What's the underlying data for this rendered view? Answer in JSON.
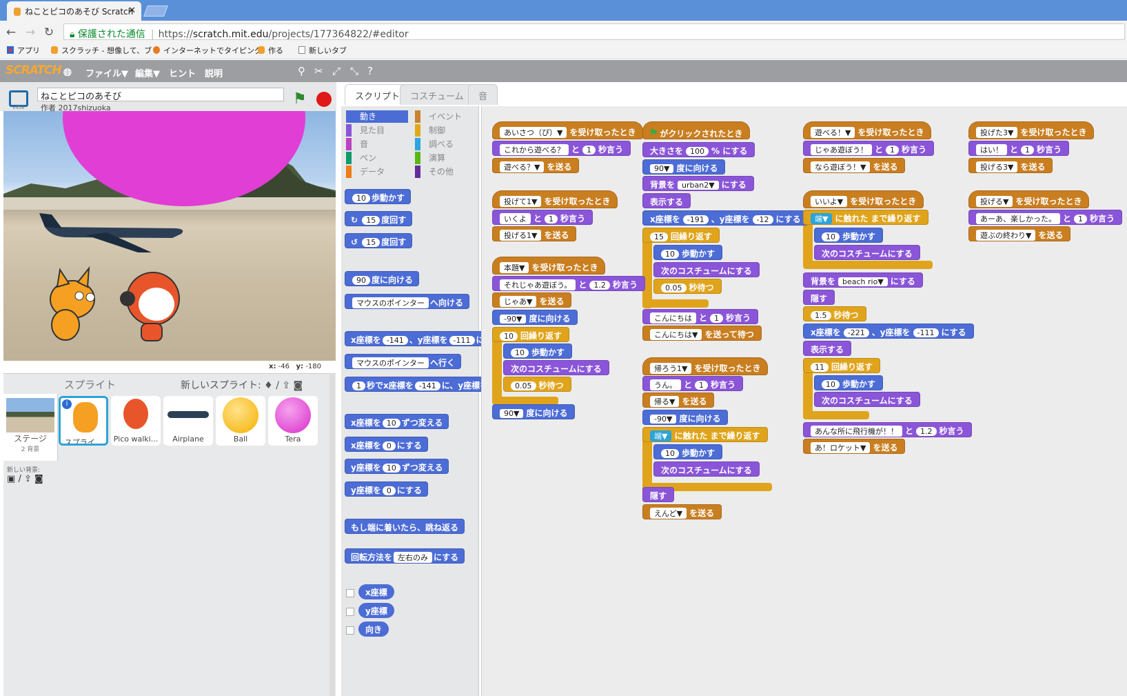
{
  "browser": {
    "tab_title": "ねことピコのあそび Scratch",
    "security_label": "保護された通信",
    "url_prefix": "https://",
    "url_host": "scratch.mit.edu",
    "url_path": "/projects/177364822/#editor",
    "bookmarks": [
      "アプリ",
      "スクラッチ - 想像して、ブ",
      "インターネットでタイピング",
      "作る",
      "新しいタブ"
    ]
  },
  "menubar": {
    "logo": "SCRATCH",
    "file": "ファイル▼",
    "edit": "編集▼",
    "hint": "ヒント",
    "about": "説明"
  },
  "stage": {
    "project_title": "ねことピコのあそび",
    "author": "作者 2017shizuoka",
    "version": "v458",
    "x_label": "x:",
    "x_value": "-46",
    "y_label": "y:",
    "y_value": "-180"
  },
  "sprites": {
    "header": "スプライト",
    "new_sprite": "新しいスプライト:",
    "stage_label": "ステージ",
    "stage_sub": "2 背景",
    "new_bg": "新しい背景:",
    "items": [
      "スプライ...",
      "Pico walki...",
      "Airplane",
      "Ball",
      "Tera"
    ]
  },
  "tabs": [
    "スクリプト",
    "コスチューム",
    "音"
  ],
  "categories": {
    "left": [
      "動き",
      "見た目",
      "音",
      "ペン",
      "データ"
    ],
    "right": [
      "イベント",
      "制御",
      "調べる",
      "演算",
      "その他"
    ],
    "left_colors": [
      "#4a6cd4",
      "#8a55d8",
      "#bb42c3",
      "#0e9a6c",
      "#ee7d16"
    ],
    "right_colors": [
      "#c88330",
      "#e1a91a",
      "#2ca5e2",
      "#5cb712",
      "#632d99"
    ]
  },
  "palette": {
    "move": "歩動かす",
    "move_n": "10",
    "turn_cw": "度回す",
    "turn_n": "15",
    "point_dir": "度に向ける",
    "dir_n": "90",
    "point_towards": "へ向ける",
    "mouse_pointer": "マウスのポインター",
    "goto_xy_x": "x座標を",
    "goto_xy_xv": "-141",
    "goto_xy_y": "、y座標を",
    "goto_xy_yv": "-111",
    "goto_xy_end": "に",
    "goto": "へ行く",
    "glide_a": "秒でx座標を",
    "glide_n": "1",
    "glide_b": "に、y座標を",
    "change_x": "ずつ変える",
    "set_x_to": "にする",
    "zero": "0",
    "bounce": "もし端に着いたら、跳ね返る",
    "rotation_style": "回転方法を",
    "rotation_val": "左右のみ",
    "x_pos": "x座標",
    "y_pos": "y座標",
    "direction": "向き",
    "y_label": "y座標を"
  },
  "scripts": {
    "col1": [
      {
        "kind": "hat events",
        "parts": [
          "あいさつ（ぴ）▼",
          "を受け取ったとき"
        ]
      },
      {
        "kind": "looks",
        "parts": [
          "これから遊べる？",
          "と",
          "1",
          "秒言う"
        ]
      },
      {
        "kind": "events",
        "parts": [
          "遊べる？▼",
          "を送る"
        ]
      },
      {
        "kind": "hat events",
        "parts": [
          "投げて1▼",
          "を受け取ったとき"
        ]
      },
      {
        "kind": "looks",
        "parts": [
          "いくよ",
          "と",
          "1",
          "秒言う"
        ]
      },
      {
        "kind": "events",
        "parts": [
          "投げる1▼",
          "を送る"
        ]
      },
      {
        "kind": "hat events",
        "parts": [
          "本題▼",
          "を受け取ったとき"
        ]
      },
      {
        "kind": "looks",
        "parts": [
          "それじゃあ遊ぼう。",
          "と",
          "1.2",
          "秒言う"
        ]
      },
      {
        "kind": "events",
        "parts": [
          "じゃあ▼",
          "を送る"
        ]
      },
      {
        "kind": "motion",
        "parts": [
          "-90▼",
          "度に向ける"
        ]
      },
      {
        "kind": "control",
        "parts": [
          "10",
          "回繰り返す"
        ]
      },
      {
        "kind": "motion",
        "parts": [
          "10",
          "歩動かす"
        ]
      },
      {
        "kind": "looks",
        "parts": [
          "次のコスチュームにする"
        ]
      },
      {
        "kind": "control",
        "parts": [
          "0.05",
          "秒待つ"
        ]
      },
      {
        "kind": "motion",
        "parts": [
          "90▼",
          "度に向ける"
        ]
      }
    ],
    "col2": [
      {
        "kind": "hat events",
        "parts": [
          "⚑",
          "がクリックされたとき"
        ]
      },
      {
        "kind": "looks",
        "parts": [
          "大きさを",
          "100",
          "% にする"
        ]
      },
      {
        "kind": "motion",
        "parts": [
          "90▼",
          "度に向ける"
        ]
      },
      {
        "kind": "looks",
        "parts": [
          "背景を",
          "urban2▼",
          "にする"
        ]
      },
      {
        "kind": "looks",
        "parts": [
          "表示する"
        ]
      },
      {
        "kind": "motion",
        "parts": [
          "x座標を",
          "-191",
          "、y座標を",
          "-12",
          "にする"
        ]
      },
      {
        "kind": "control",
        "parts": [
          "15",
          "回繰り返す"
        ]
      },
      {
        "kind": "motion",
        "parts": [
          "10",
          "歩動かす"
        ]
      },
      {
        "kind": "looks",
        "parts": [
          "次のコスチュームにする"
        ]
      },
      {
        "kind": "control",
        "parts": [
          "0.05",
          "秒待つ"
        ]
      },
      {
        "kind": "looks",
        "parts": [
          "こんにちは",
          "と",
          "1",
          "秒言う"
        ]
      },
      {
        "kind": "events",
        "parts": [
          "こんにちは▼",
          "を送って待つ"
        ]
      },
      {
        "kind": "hat events",
        "parts": [
          "帰ろう1▼",
          "を受け取ったとき"
        ]
      },
      {
        "kind": "looks",
        "parts": [
          "うん。",
          "と",
          "1",
          "秒言う"
        ]
      },
      {
        "kind": "events",
        "parts": [
          "帰る▼",
          "を送る"
        ]
      },
      {
        "kind": "motion",
        "parts": [
          "-90▼",
          "度に向ける"
        ]
      },
      {
        "kind": "control",
        "parts": [
          "端▼",
          "に触れた",
          "まで繰り返す"
        ]
      },
      {
        "kind": "motion",
        "parts": [
          "10",
          "歩動かす"
        ]
      },
      {
        "kind": "looks",
        "parts": [
          "次のコスチュームにする"
        ]
      },
      {
        "kind": "looks",
        "parts": [
          "隠す"
        ]
      },
      {
        "kind": "events",
        "parts": [
          "えんど▼",
          "を送る"
        ]
      }
    ],
    "col3": [
      {
        "kind": "hat events",
        "parts": [
          "遊べる！▼",
          "を受け取ったとき"
        ]
      },
      {
        "kind": "looks",
        "parts": [
          "じゃあ遊ぼう！",
          "と",
          "1",
          "秒言う"
        ]
      },
      {
        "kind": "events",
        "parts": [
          "なら遊ぼう！▼",
          "を送る"
        ]
      },
      {
        "kind": "hat events",
        "parts": [
          "いいよ▼",
          "を受け取ったとき"
        ]
      },
      {
        "kind": "control",
        "parts": [
          "端▼",
          "に触れた",
          "まで繰り返す"
        ]
      },
      {
        "kind": "motion",
        "parts": [
          "10",
          "歩動かす"
        ]
      },
      {
        "kind": "looks",
        "parts": [
          "次のコスチュームにする"
        ]
      },
      {
        "kind": "looks",
        "parts": [
          "背景を",
          "beach rio▼",
          "にする"
        ]
      },
      {
        "kind": "looks",
        "parts": [
          "隠す"
        ]
      },
      {
        "kind": "control",
        "parts": [
          "1.5",
          "秒待つ"
        ]
      },
      {
        "kind": "motion",
        "parts": [
          "x座標を",
          "-221",
          "、y座標を",
          "-111",
          "にする"
        ]
      },
      {
        "kind": "looks",
        "parts": [
          "表示する"
        ]
      },
      {
        "kind": "control",
        "parts": [
          "11",
          "回繰り返す"
        ]
      },
      {
        "kind": "motion",
        "parts": [
          "10",
          "歩動かす"
        ]
      },
      {
        "kind": "looks",
        "parts": [
          "次のコスチュームにする"
        ]
      },
      {
        "kind": "looks",
        "parts": [
          "あんな所に飛行機が！！",
          "と",
          "1.2",
          "秒言う"
        ]
      },
      {
        "kind": "events",
        "parts": [
          "あ！ロケット▼",
          "を送る"
        ]
      }
    ],
    "col4": [
      {
        "kind": "hat events",
        "parts": [
          "投げた3▼",
          "を受け取ったとき"
        ]
      },
      {
        "kind": "looks",
        "parts": [
          "はい！",
          "と",
          "1",
          "秒言う"
        ]
      },
      {
        "kind": "events",
        "parts": [
          "投げる3▼",
          "を送る"
        ]
      },
      {
        "kind": "hat events",
        "parts": [
          "投げる▼",
          "を受け取ったとき"
        ]
      },
      {
        "kind": "looks",
        "parts": [
          "あーあ、楽しかった。",
          "と",
          "1",
          "秒言う"
        ]
      },
      {
        "kind": "events",
        "parts": [
          "遊ぶの終わり▼",
          "を送る"
        ]
      }
    ]
  }
}
